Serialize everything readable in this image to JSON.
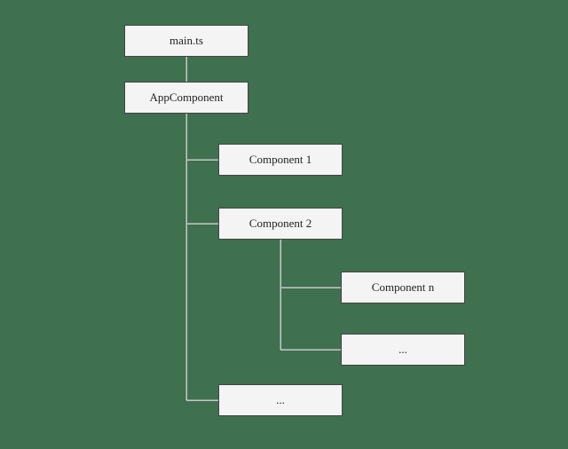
{
  "chart_data": {
    "type": "tree",
    "title": "",
    "nodes": {
      "root": {
        "label": "main.ts"
      },
      "app": {
        "label": "AppComponent"
      },
      "c1": {
        "label": "Component 1"
      },
      "c2": {
        "label": "Component 2"
      },
      "cn": {
        "label": "Component n"
      },
      "dots_c2": {
        "label": "..."
      },
      "dots_app": {
        "label": "..."
      }
    },
    "edges": [
      [
        "root",
        "app"
      ],
      [
        "app",
        "c1"
      ],
      [
        "app",
        "c2"
      ],
      [
        "app",
        "dots_app"
      ],
      [
        "c2",
        "cn"
      ],
      [
        "c2",
        "dots_c2"
      ]
    ]
  },
  "colors": {
    "background": "#3f704f",
    "node_fill": "#f4f4f4",
    "node_border": "#444444",
    "connector": "#c7c7c7"
  }
}
